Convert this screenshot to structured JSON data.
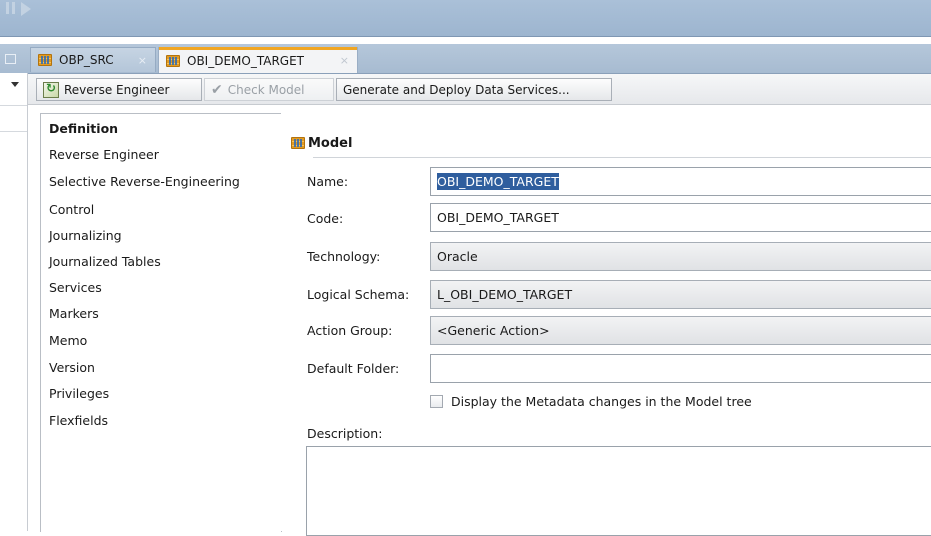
{
  "tabs": [
    {
      "label": "OBP_SRC",
      "close": "×"
    },
    {
      "label": "OBI_DEMO_TARGET",
      "close": "×"
    }
  ],
  "toolbar": {
    "reverse_engineer": "Reverse Engineer",
    "check_model": "Check Model",
    "generate_deploy": "Generate and Deploy Data Services..."
  },
  "nav": [
    "Definition",
    "Reverse Engineer",
    "Selective Reverse-Engineering",
    "Control",
    "Journalizing",
    "Journalized Tables",
    "Services",
    "Markers",
    "Memo",
    "Version",
    "Privileges",
    "Flexfields"
  ],
  "form": {
    "header": "Model",
    "name_label": "Name:",
    "name_value": "OBI_DEMO_TARGET",
    "code_label": "Code:",
    "code_value": "OBI_DEMO_TARGET",
    "technology_label": "Technology:",
    "technology_value": "Oracle",
    "logical_schema_label": "Logical Schema:",
    "logical_schema_value": "L_OBI_DEMO_TARGET",
    "action_group_label": "Action Group:",
    "action_group_value": "<Generic Action>",
    "default_folder_label": "Default Folder:",
    "default_folder_value": "",
    "metadata_checkbox_label": "Display the Metadata changes in the Model tree",
    "metadata_checkbox_checked": false,
    "description_label": "Description:",
    "description_value": ""
  }
}
